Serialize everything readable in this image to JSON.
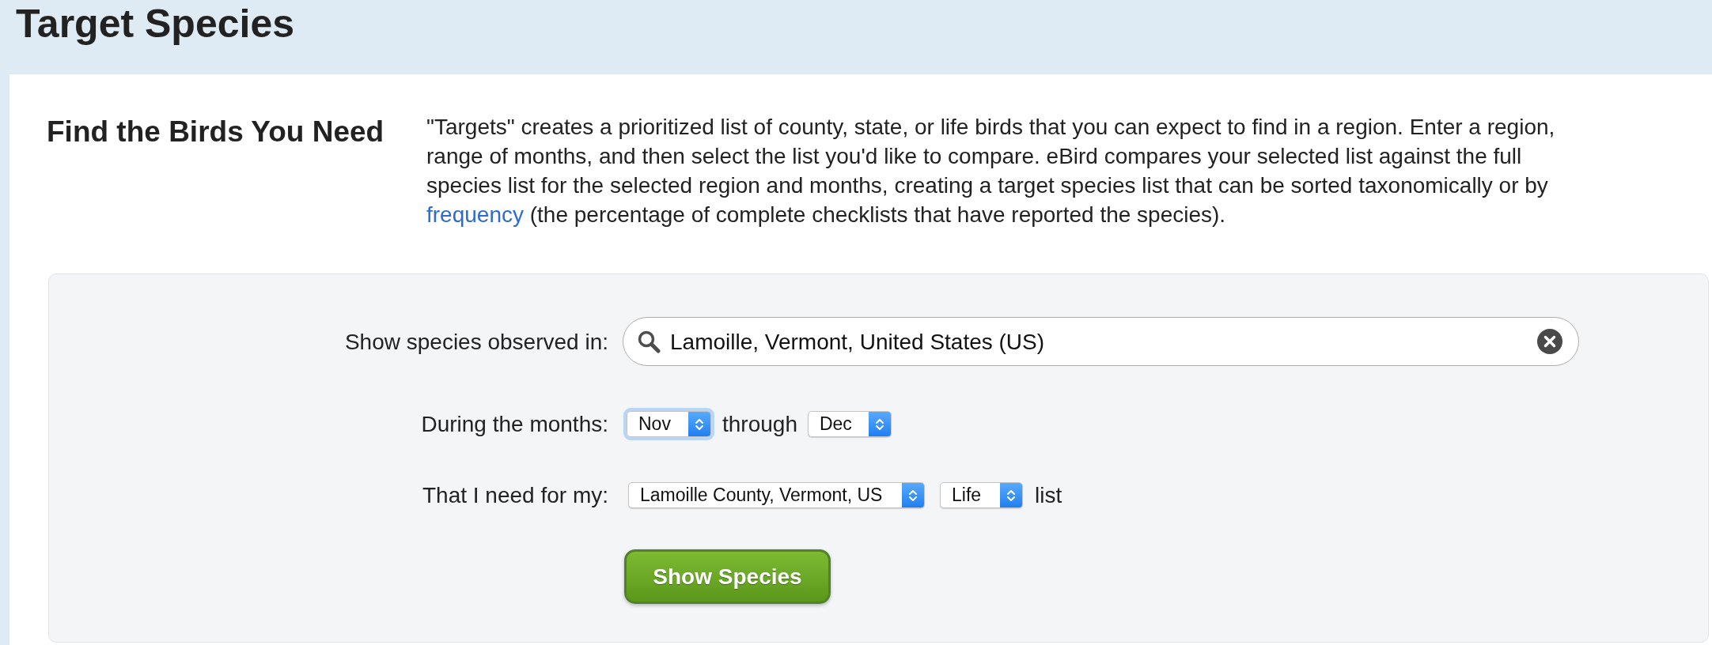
{
  "header": {
    "title": "Target Species"
  },
  "intro": {
    "heading": "Find the Birds You Need",
    "description": {
      "before": "\"Targets\" creates a prioritized list of county, state, or life birds that you can expect to find in a region. Enter a region, range of months, and then select the list you'd like to compare. eBird compares your selected list against the full species list for the selected region and months, creating a target species list that can be sorted taxonomically or by",
      "link": "frequency",
      "after": "(the percentage of complete checklists that have reported the species)."
    }
  },
  "form": {
    "region": {
      "label": "Show species observed in:",
      "value": "Lamoille, Vermont, United States (US)"
    },
    "months": {
      "label": "During the months:",
      "from": {
        "value": "Nov",
        "focused": true
      },
      "connector": "through",
      "to": {
        "value": "Dec",
        "focused": false
      }
    },
    "list": {
      "label": "That I need for my:",
      "region": {
        "value": "Lamoille County, Vermont, US",
        "focused": false
      },
      "type": {
        "value": "Life",
        "focused": false
      },
      "suffix": "list"
    },
    "submit": {
      "label": "Show Species"
    }
  }
}
